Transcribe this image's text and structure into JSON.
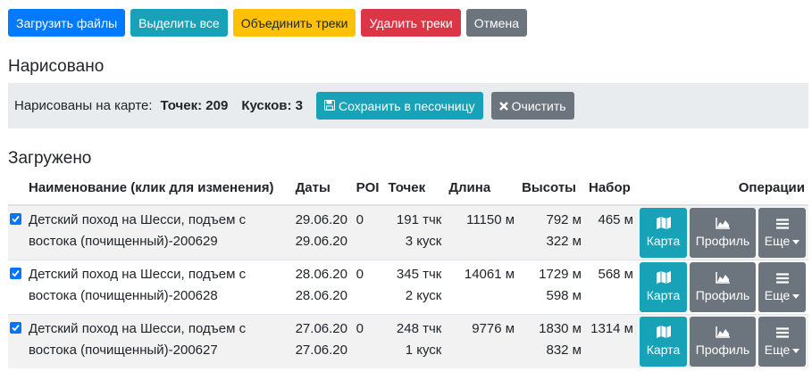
{
  "toolbar": {
    "upload": "Загрузить файлы",
    "select_all": "Выделить все",
    "merge": "Объединить треки",
    "delete": "Удалить треки",
    "cancel": "Отмена"
  },
  "drawn": {
    "heading": "Нарисовано",
    "label": "Нарисованы на карте:",
    "points_label": "Точек: 209",
    "pieces_label": "Кусков: 3",
    "save_button": "Сохранить в песочницу",
    "clear_button": "Очистить"
  },
  "loaded": {
    "heading": "Загружено",
    "columns": {
      "name": "Наименование (клик для изменения)",
      "dates": "Даты",
      "poi": "POI",
      "points": "Точек",
      "length": "Длина",
      "heights": "Высоты",
      "ascent": "Набор",
      "operations": "Операции"
    },
    "rows": [
      {
        "name": "Детский поход на Шесси, подъем с востока (почищенный)-200629",
        "date1": "29.06.20",
        "date2": "29.06.20",
        "poi": "0",
        "points": "191 тчк",
        "pieces": "3 куск",
        "length": "11150 м",
        "h_max": "792 м",
        "h_min": "322 м",
        "ascent": "465 м"
      },
      {
        "name": "Детский поход на Шесси, подъем с востока (почищенный)-200628",
        "date1": "28.06.20",
        "date2": "28.06.20",
        "poi": "0",
        "points": "345 тчк",
        "pieces": "2 куск",
        "length": "14061 м",
        "h_max": "1729 м",
        "h_min": "598 м",
        "ascent": "568 м"
      },
      {
        "name": "Детский поход на Шесси, подъем с востока (почищенный)-200627",
        "date1": "27.06.20",
        "date2": "27.06.20",
        "poi": "0",
        "points": "248 тчк",
        "pieces": "1 куск",
        "length": "9776 м",
        "h_max": "1830 м",
        "h_min": "832 м",
        "ascent": "1314 м"
      }
    ],
    "op_labels": {
      "map": "Карта",
      "profile": "Профиль",
      "more": "Еще"
    }
  },
  "icons": [
    "floppy-disk-icon",
    "close-icon",
    "map-icon",
    "area-chart-icon",
    "menu-icon",
    "caret-down-icon",
    "checkbox-checked-icon"
  ]
}
